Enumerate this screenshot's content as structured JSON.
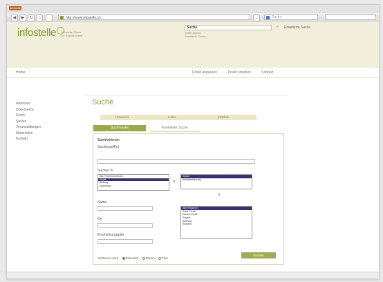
{
  "browser": {
    "app_badge": "infostelle",
    "url": "http://www.infostelle.ch",
    "search_placeholder": "Suche",
    "back": "◀",
    "forward": "▶",
    "reload": "↻",
    "home": "⌂",
    "go": "→"
  },
  "header": {
    "brand": "infostelle",
    "brand_sub_1": "Infostelle Zürich",
    "brand_sub_2": "für Soziale Arbeit",
    "search_label": "Suche",
    "search_value": "Suche",
    "search_sub_1": "Volltextsuche",
    "search_sub_2": "Erweiterte Suche",
    "search_go": "→",
    "advanced_link": "Erweiterte Suche"
  },
  "subnav": {
    "home": "Home",
    "links": [
      "Direkt anpassen",
      "Direkt erstellen",
      "Kontakt"
    ]
  },
  "leftnav": {
    "items": [
      "Adressen",
      "Dokumente",
      "Kurse",
      "Stellen",
      "Veranstaltungen",
      "Materialien",
      "Kontakt"
    ]
  },
  "main": {
    "title": "Suche",
    "tabs_top": [
      "Übersicht",
      "Listen",
      "Infothek"
    ],
    "tab_active": "Suchmaske",
    "tab_inactive": "Erweiterte Suche",
    "section_title": "Suchkriterien",
    "field_keyword": "Suchbegriff(e)",
    "field_category": "Suchen in",
    "list_left": [
      "Alle Themenbereiche",
      "Arbeit",
      "Bildung",
      "Erziehung"
    ],
    "list_right_top": [
      "Kinder",
      "Kinderbetreuung"
    ],
    "list_right_bottom": [
      "Alle Regionen",
      "Stadt Zürich",
      "Kanton Zürich",
      "Region",
      "Schweiz",
      "Ausland"
    ],
    "field_name": "Name",
    "field_place": "Ort",
    "field_date": "Erscheinungsjahr",
    "sort_label": "Sortieren nach",
    "sort_options": [
      "Relevanz",
      "Datum",
      "Titel"
    ],
    "submit": "Suchen"
  }
}
